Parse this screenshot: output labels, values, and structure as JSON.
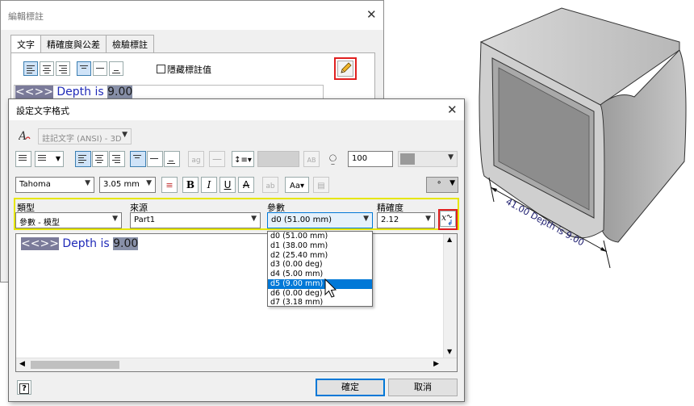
{
  "back_dialog": {
    "title": "編輯標註",
    "tabs": [
      "文字",
      "精確度與公差",
      "檢驗標註"
    ],
    "hide_value_label": "隱藏標註值",
    "text_token": "<<>>",
    "text_mid": " Depth is ",
    "text_value": "9.00"
  },
  "front_dialog": {
    "title": "設定文字格式",
    "style_combo": "註記文字 (ANSI) - 3D",
    "percent_value": "100",
    "font_combo": "Tahoma",
    "size_combo": "3.05 mm",
    "bold_label": "B",
    "italic_label": "I",
    "underline_label": "U",
    "strike_label": "A",
    "param_row": {
      "type_label": "類型",
      "type_value": "參數 - 模型",
      "source_label": "來源",
      "source_value": "Part1",
      "param_label": "參數",
      "param_value": "d0 (51.00 mm)",
      "precision_label": "精確度",
      "precision_value": "2.12"
    },
    "param_options": [
      "d0 (51.00 mm)",
      "d1 (38.00 mm)",
      "d2 (25.40 mm)",
      "d3 (0.00 deg)",
      "d4 (5.00 mm)",
      "d5 (9.00 mm)",
      "d6 (0.00 deg)",
      "d7 (3.18 mm)"
    ],
    "param_selected_index": 5,
    "editor_token": "<<>>",
    "editor_mid": " Depth is ",
    "editor_value": "9.00",
    "ok_label": "確定",
    "cancel_label": "取消",
    "help_label": "?"
  },
  "model_view": {
    "dimension_text": "41.00 Depth is 9.00"
  },
  "colors": {
    "highlight_yellow": "#e6e600",
    "highlight_red": "#e02020",
    "selection_blue": "#0078d7",
    "text_navy": "#1f2ab8"
  },
  "icons": [
    "pencil-icon",
    "text-style-icon",
    "bullets-icon",
    "numbering-icon",
    "align-left-icon",
    "align-center-icon",
    "align-right-icon",
    "valign-top-icon",
    "valign-middle-icon",
    "valign-bottom-icon",
    "line-spacing-icon",
    "symbol-icon",
    "insert-parameter-icon",
    "help-icon"
  ]
}
